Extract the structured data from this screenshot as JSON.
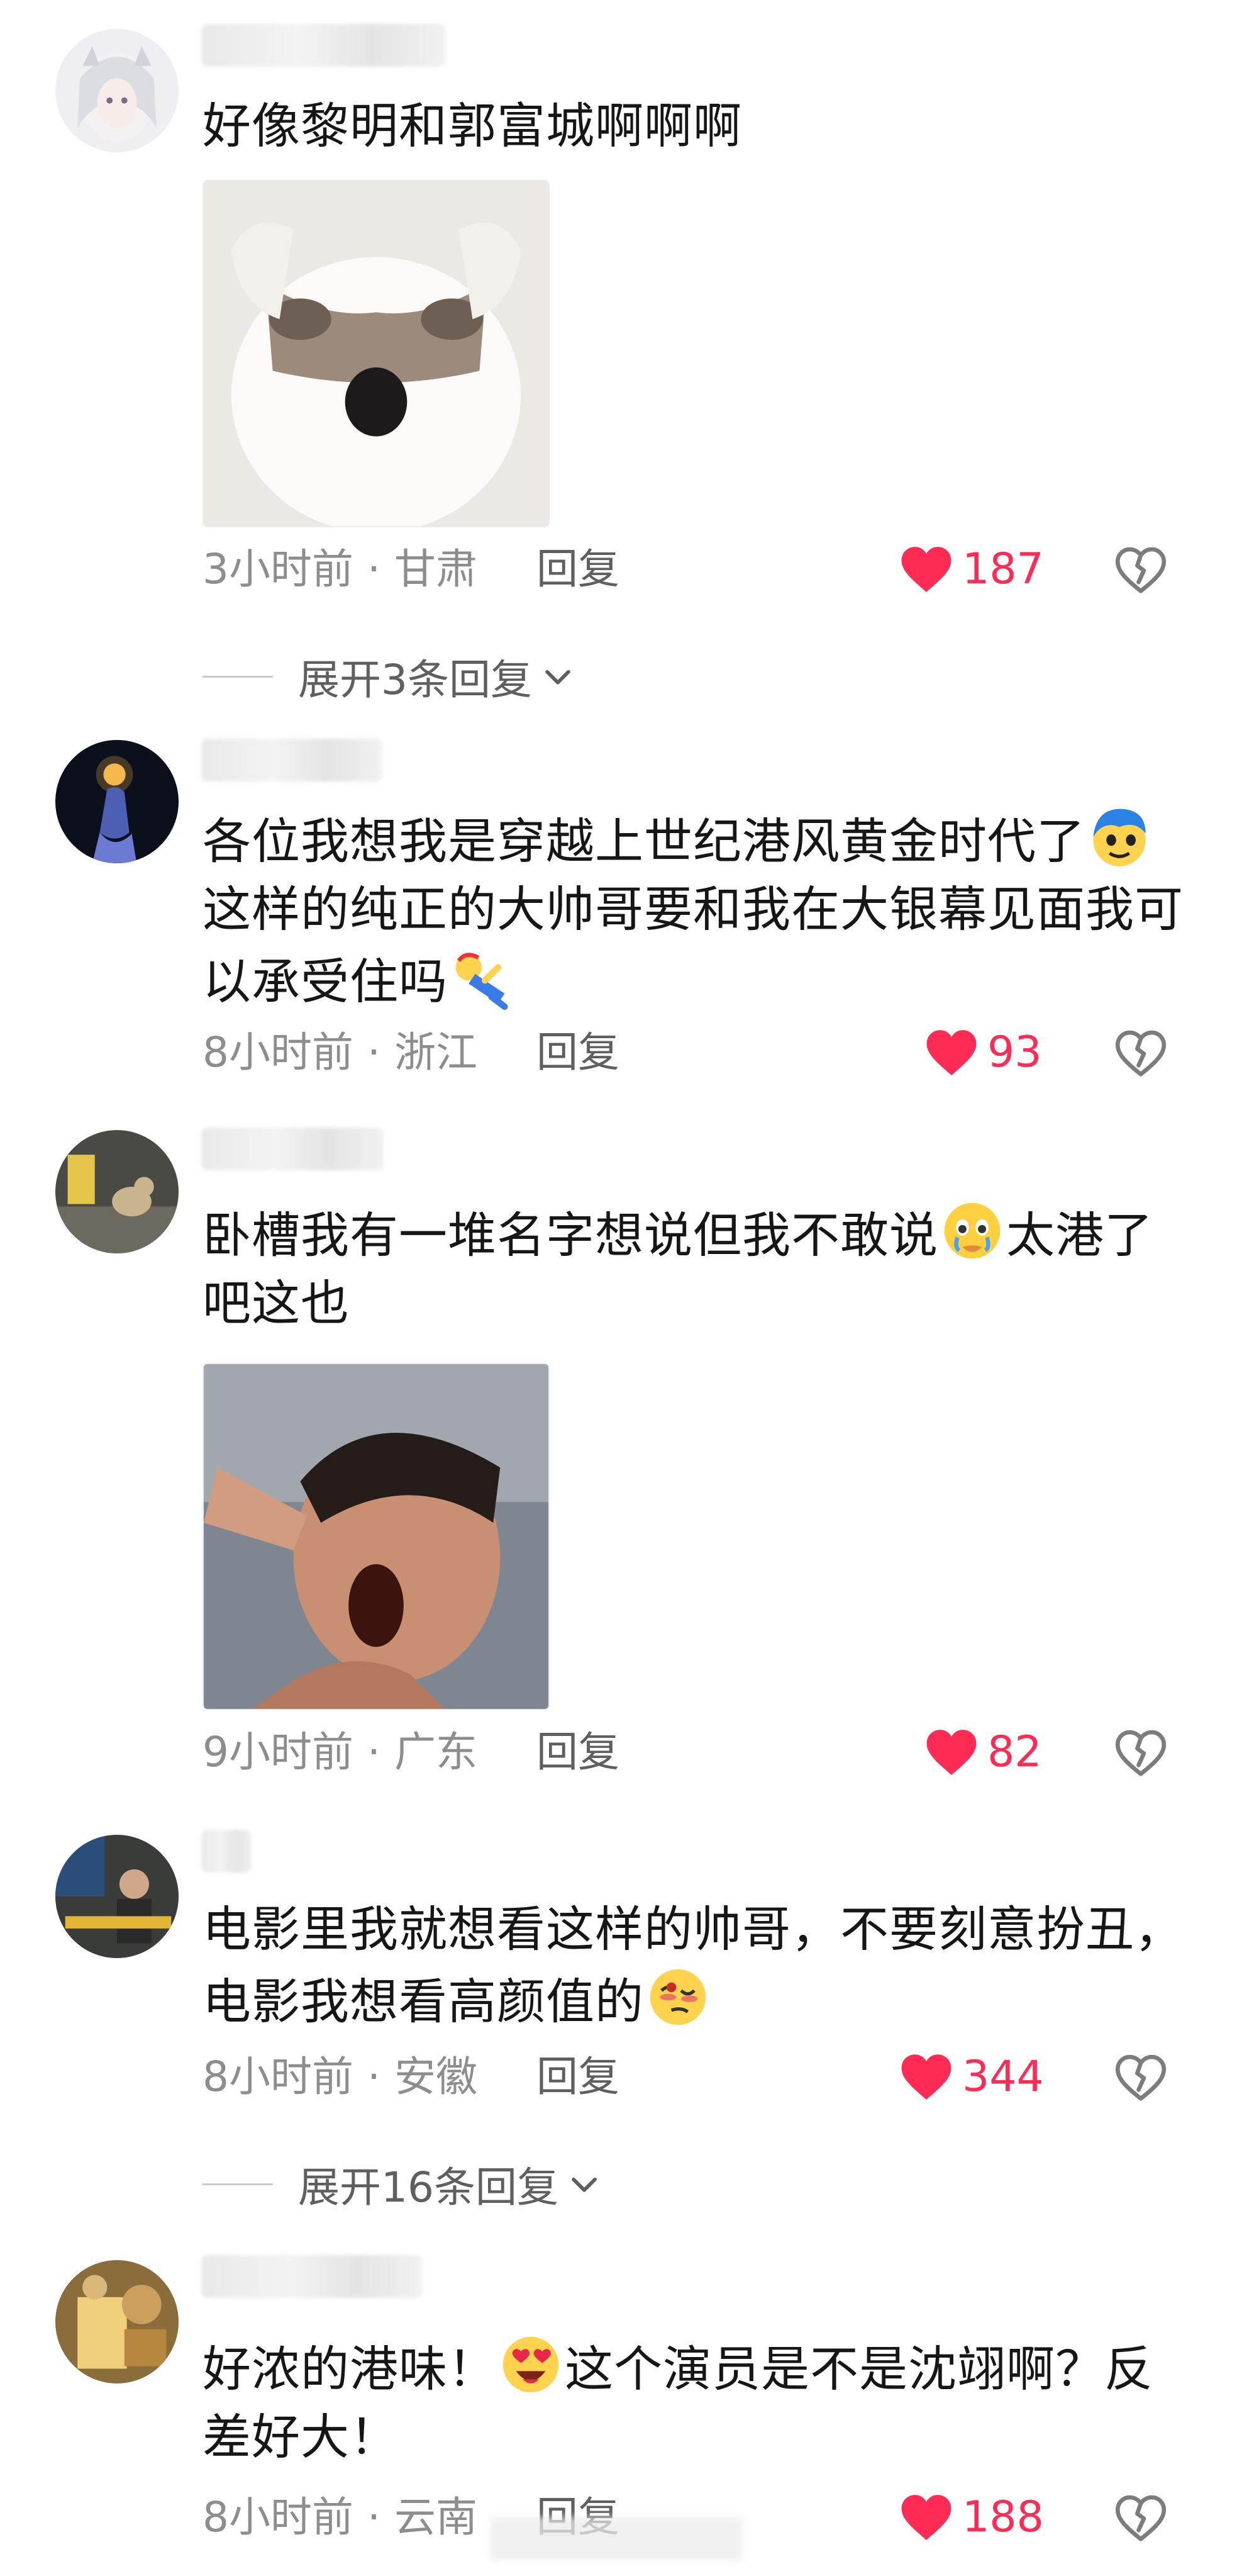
{
  "comments": [
    {
      "text": "好像黎明和郭富城啊啊啊",
      "time": "3小时前",
      "location": "甘肃",
      "reply": "回复",
      "likes": "187",
      "expand": "展开3条回复"
    },
    {
      "text_parts": [
        "各位我想我是穿越上世纪港风黄金时代了",
        "这样的纯正的大帅哥要和我在大银幕见面我可以承受住吗"
      ],
      "time": "8小时前",
      "location": "浙江",
      "reply": "回复",
      "likes": "93"
    },
    {
      "text_parts": [
        "卧槽我有一堆名字想说但我不敢说",
        "太港了吧这也"
      ],
      "time": "9小时前",
      "location": "广东",
      "reply": "回复",
      "likes": "82"
    },
    {
      "text": "电影里我就想看这样的帅哥，不要刻意扮丑，电影我想看高颜值的",
      "time": "8小时前",
      "location": "安徽",
      "reply": "回复",
      "likes": "344",
      "expand": "展开16条回复"
    },
    {
      "text_parts": [
        "好浓的港味！",
        "这个演员是不是沈翊啊？反差好大！"
      ],
      "time": "8小时前",
      "location": "云南",
      "reply": "回复",
      "likes": "188"
    }
  ],
  "separator": "·",
  "colors": {
    "like": "#fe2c55",
    "meta": "#8d8d8d",
    "text": "#161616"
  },
  "icons": [
    "heart-icon",
    "dislike-heart-icon",
    "chevron-down-icon"
  ]
}
